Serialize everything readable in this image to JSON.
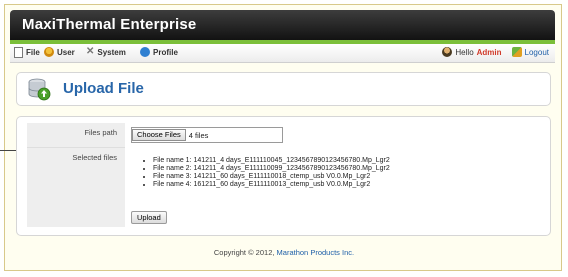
{
  "app": {
    "title": "MaxiThermal Enterprise"
  },
  "menu": {
    "items": [
      {
        "label": "File",
        "icon": "file-icon"
      },
      {
        "label": "User",
        "icon": "user-icon"
      },
      {
        "label": "System",
        "icon": "wrench-icon"
      },
      {
        "label": "Profile",
        "icon": "info-icon"
      }
    ],
    "hello": "Hello",
    "admin": "Admin",
    "logout": "Logout"
  },
  "page": {
    "title": "Upload File"
  },
  "form": {
    "files_path_label": "Files path",
    "choose_files_label": "Choose Files",
    "file_count": "4 files",
    "selected_files_label": "Selected files",
    "selected_files": [
      "File name 1: 141211_4 days_E111110045_1234567890123456780.Mp_Lgr2",
      "File name 2: 141211_4 days_E111110099_1234567890123456780.Mp_Lgr2",
      "File name 3: 141211_60 days_E111110018_ctemp_usb V0.0.Mp_Lgr2",
      "File name 4: 161211_60 days_E111110013_ctemp_usb V0.0.Mp_Lgr2"
    ],
    "upload_label": "Upload"
  },
  "footer": {
    "copyright": "Copyright © 2012,",
    "company": "Marathon Products Inc."
  },
  "colors": {
    "accent": "#2866a9",
    "green_bar": "#7bbf3a",
    "admin": "#d03a2a"
  }
}
